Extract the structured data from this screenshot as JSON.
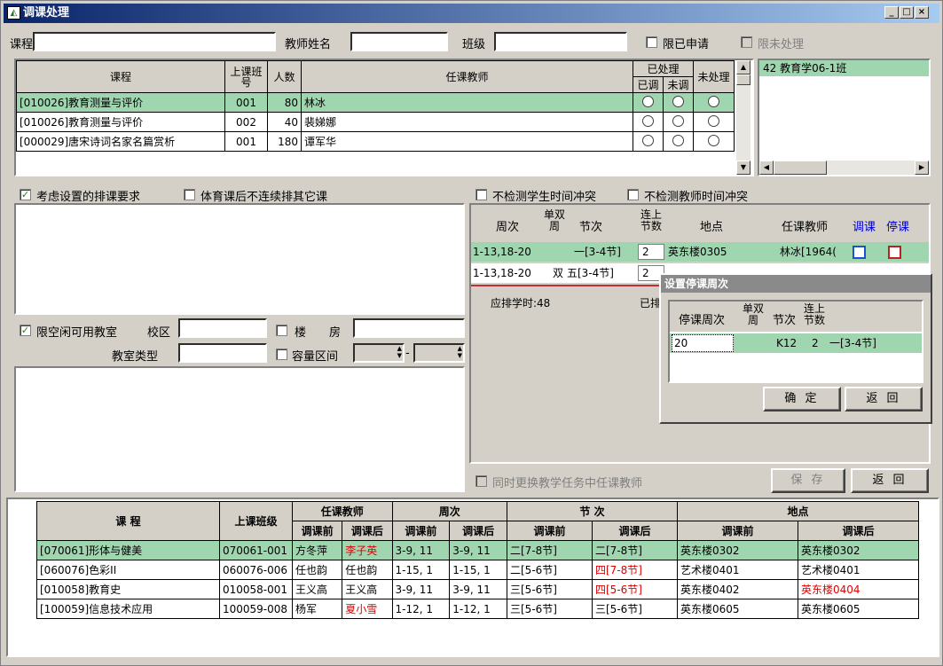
{
  "window": {
    "title": "调课处理",
    "min": "_",
    "max": "□",
    "close": "×"
  },
  "filters": {
    "course_label": "课程",
    "course_value": "",
    "teacher_label": "教师姓名",
    "teacher_value": "",
    "class_label": "班级",
    "class_value": "",
    "applied_label": "限已申请",
    "unprocessed_label": "限未处理"
  },
  "course_table": {
    "headers": {
      "course": "课程",
      "class_no": "上课班号",
      "count": "人数",
      "teacher": "任课教师",
      "processed": "已处理",
      "adjusted": "已调",
      "not_adjusted": "未调",
      "unprocessed": "未处理"
    },
    "rows": [
      {
        "course": "[010026]教育测量与评价",
        "class_no": "001",
        "count": "80",
        "teacher": "林冰"
      },
      {
        "course": "[010026]教育测量与评价",
        "class_no": "002",
        "count": "40",
        "teacher": "裴娣娜"
      },
      {
        "course": "[000029]唐宋诗词名家名篇赏析",
        "class_no": "001",
        "count": "180",
        "teacher": "谭军华"
      }
    ]
  },
  "class_list": {
    "item": "42  教育学06-1班"
  },
  "options": {
    "consider_requirements": "考虑设置的排课要求",
    "pe_no_consecutive": "体育课后不连续排其它课",
    "no_student_conflict": "不检测学生时间冲突",
    "no_teacher_conflict": "不检测教师时间冲突",
    "limit_free_rooms": "限空闲可用教室",
    "campus_label": "校区",
    "building_label": "楼",
    "room_label": "房",
    "room_type_label": "教室类型",
    "capacity_label": "容量区间"
  },
  "schedule_table": {
    "headers": {
      "weeks": "周次",
      "odd_even": "单双周",
      "period": "节次",
      "consecutive": "连上节数",
      "place": "地点",
      "teacher": "任课教师",
      "adjust": "调课",
      "stop": "停课"
    },
    "rows": [
      {
        "weeks": "1-13,18-20",
        "odd_even": "",
        "period": "一[3-4节]",
        "consecutive": "2",
        "place": "英东楼0305",
        "teacher": "林冰[1964("
      },
      {
        "weeks": "1-13,18-20",
        "odd_even": "双",
        "period": "五[3-4节]",
        "consecutive": "2",
        "place": "英东楼",
        "teacher": "林冰"
      }
    ],
    "required_hours": "应排学时:48",
    "scheduled_hours": "已排"
  },
  "popup": {
    "title": "设置停课周次",
    "headers": {
      "stop_weeks": "停课周次",
      "odd_even": "单双周",
      "period": "节次",
      "consecutive": "连上节数"
    },
    "row": {
      "stop_weeks": "20",
      "course": "K12",
      "consecutive": "2",
      "period": "一[3-4节]"
    },
    "ok": "确 定",
    "back": "返 回"
  },
  "replace_teacher": "同时更换教学任务中任课教师",
  "buttons": {
    "save": "保 存",
    "back": "返 回"
  },
  "changes_table": {
    "headers": {
      "course": "课      程",
      "class": "上课班级",
      "teacher": "任课教师",
      "weeks": "周次",
      "period": "节      次",
      "place": "地点",
      "before": "调课前",
      "after": "调课后"
    },
    "rows": [
      {
        "course": "[070061]形体与健美",
        "class": "070061-001",
        "t_before": "方冬萍",
        "t_after": "李子英",
        "w_before": "3-9, 11",
        "w_after": "3-9, 11",
        "p_before": "二[7-8节]",
        "p_after": "二[7-8节]",
        "pl_before": "英东楼0302",
        "pl_after": "英东楼0302"
      },
      {
        "course": "[060076]色彩II",
        "class": "060076-006",
        "t_before": "任也韵",
        "t_after": "任也韵",
        "w_before": "1-15, 1",
        "w_after": "1-15, 1",
        "p_before": "二[5-6节]",
        "p_after": "四[7-8节]",
        "pl_before": "艺术楼0401",
        "pl_after": "艺术楼0401"
      },
      {
        "course": "[010058]教育史",
        "class": "010058-001",
        "t_before": "王义高",
        "t_after": "王义高",
        "w_before": "3-9, 11",
        "w_after": "3-9, 11",
        "p_before": "三[5-6节]",
        "p_after": "四[5-6节]",
        "pl_before": "英东楼0402",
        "pl_after": "英东楼0404"
      },
      {
        "course": "[100059]信息技术应用",
        "class": "100059-008",
        "t_before": "杨军",
        "t_after": "夏小雪",
        "w_before": "1-12, 1",
        "w_after": "1-12, 1",
        "p_before": "三[5-6节]",
        "p_after": "三[5-6节]",
        "pl_before": "英东楼0605",
        "pl_after": "英东楼0605"
      }
    ]
  }
}
